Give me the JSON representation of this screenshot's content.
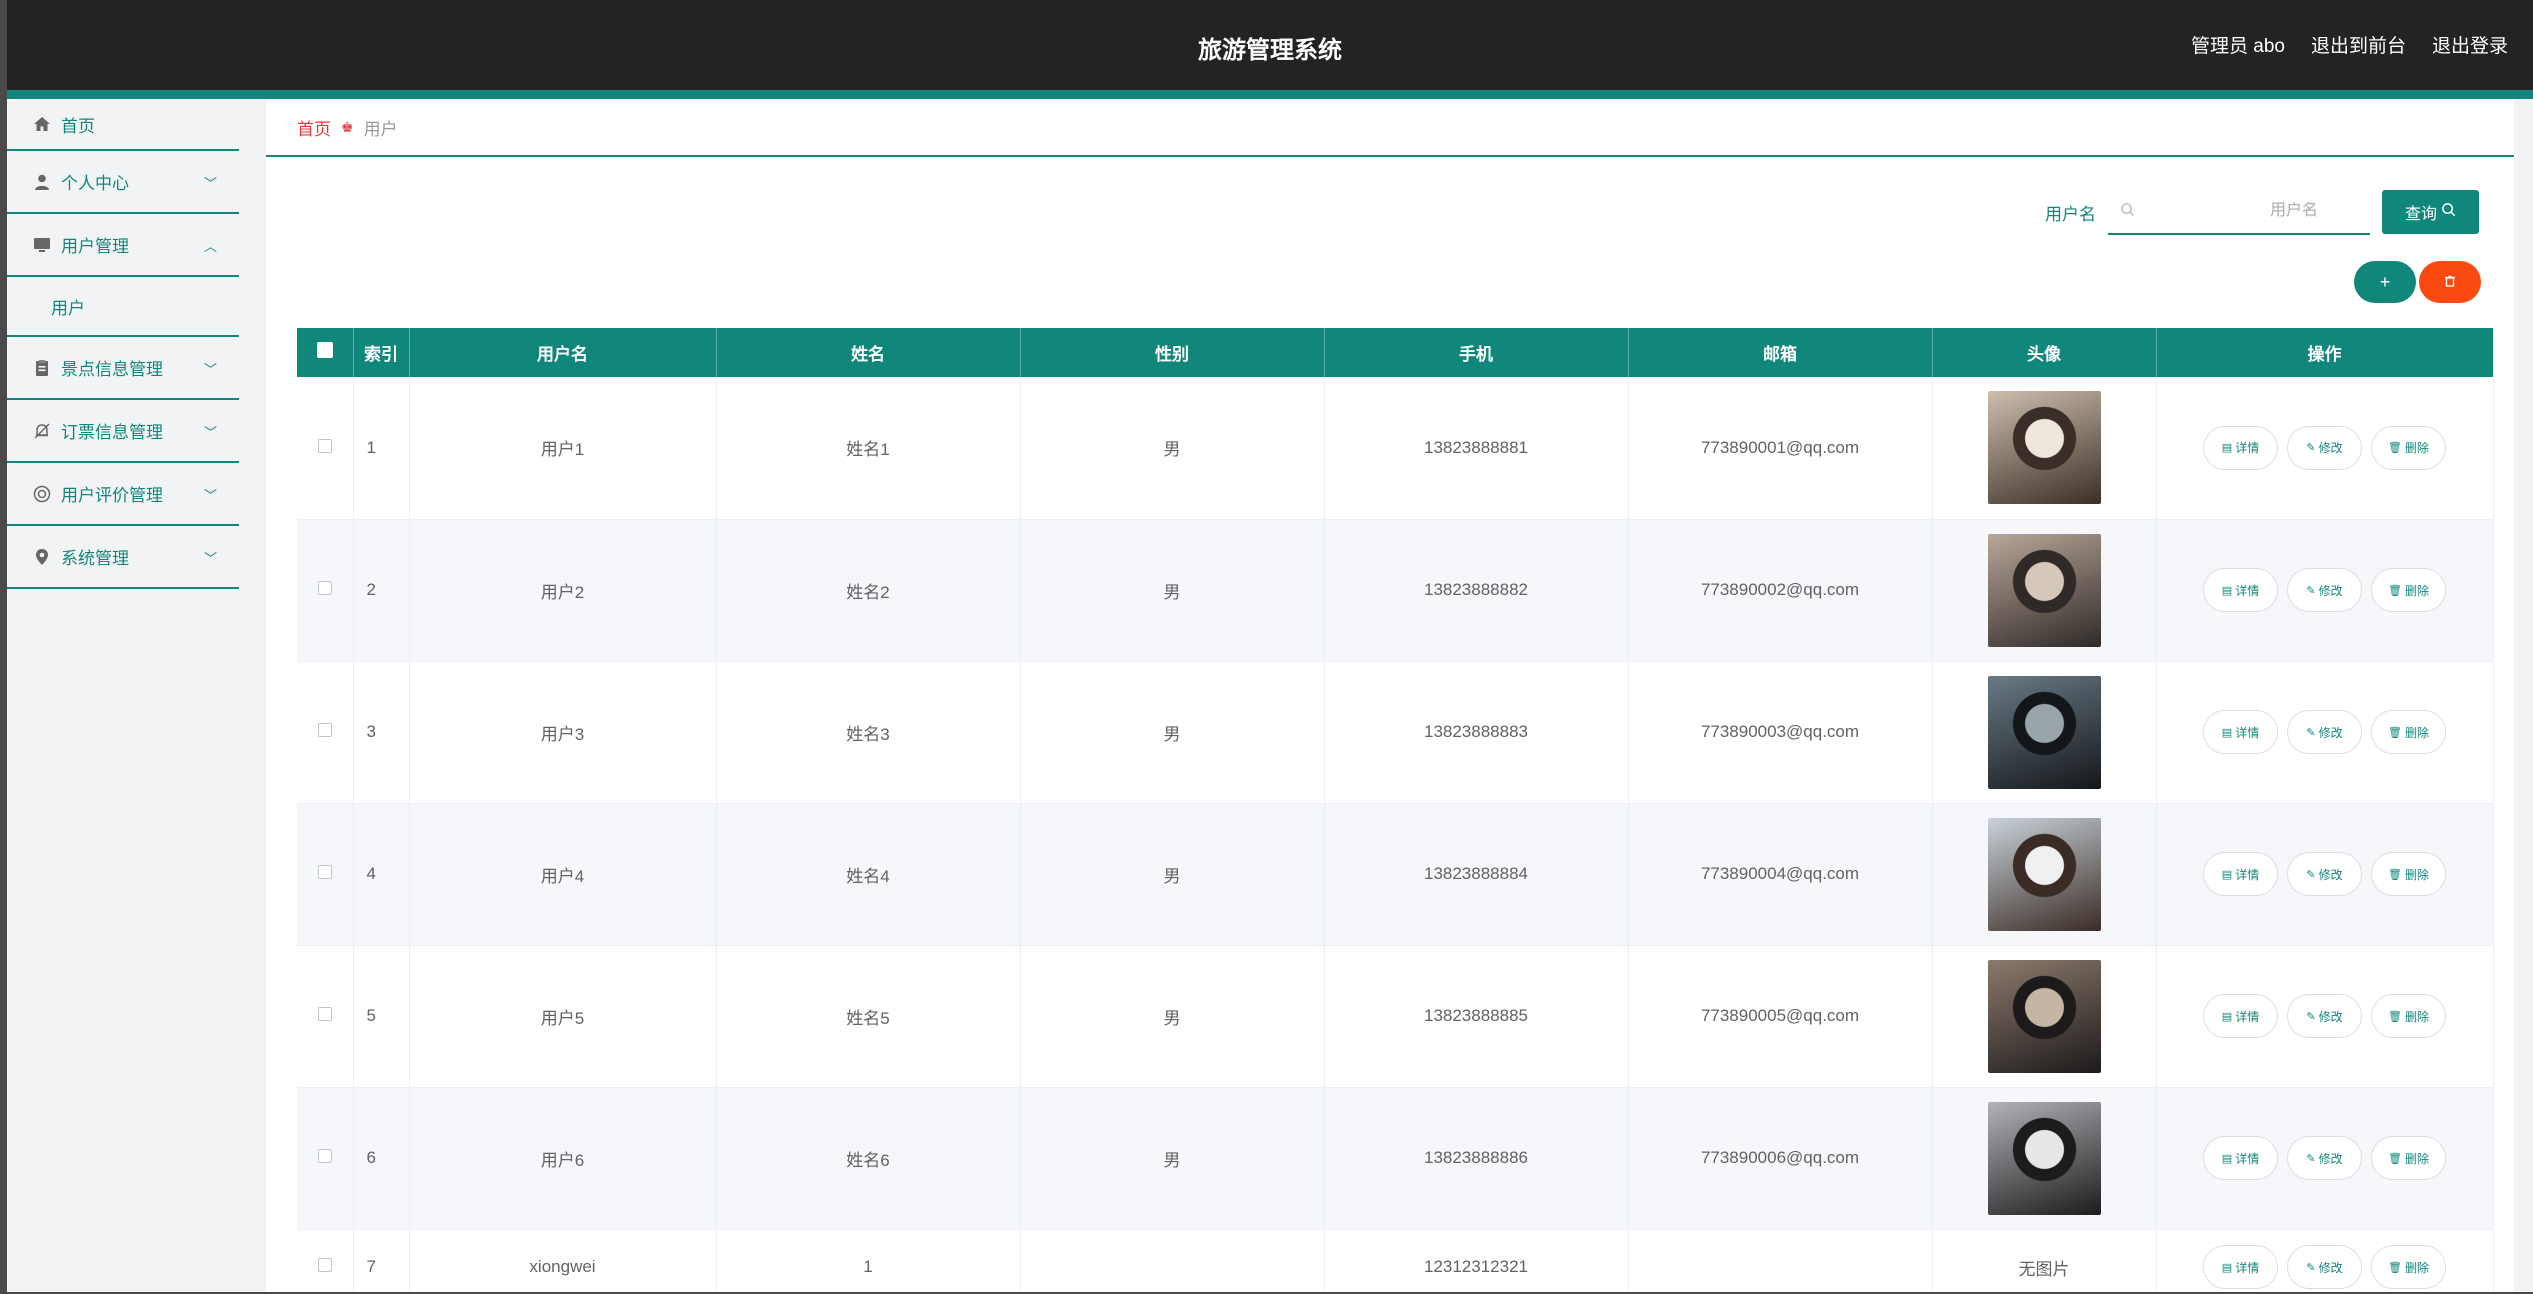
{
  "header": {
    "title": "旅游管理系统",
    "admin_label": "管理员 abo",
    "exit_front": "退出到前台",
    "logout": "退出登录"
  },
  "sidebar": {
    "home": "首页",
    "items": [
      {
        "label": "个人中心",
        "icon": "person-icon"
      },
      {
        "label": "用户管理",
        "icon": "monitor-icon",
        "expanded": true,
        "children": [
          "用户"
        ]
      },
      {
        "label": "景点信息管理",
        "icon": "clipboard-icon"
      },
      {
        "label": "订票信息管理",
        "icon": "bell-off-icon"
      },
      {
        "label": "用户评价管理",
        "icon": "chat-icon"
      },
      {
        "label": "系统管理",
        "icon": "pin-icon"
      }
    ]
  },
  "breadcrumb": {
    "home": "首页",
    "current": "用户"
  },
  "search": {
    "label": "用户名",
    "placeholder": "用户名",
    "button": "查询"
  },
  "table": {
    "headers": [
      "索引",
      "用户名",
      "姓名",
      "性别",
      "手机",
      "邮箱",
      "头像",
      "操作"
    ],
    "actions": {
      "detail": "详情",
      "edit": "修改",
      "delete": "删除"
    },
    "rows": [
      {
        "index": "1",
        "username": "用户1",
        "name": "姓名1",
        "gender": "男",
        "phone": "13823888881",
        "email": "773890001@qq.com",
        "avatar": ""
      },
      {
        "index": "2",
        "username": "用户2",
        "name": "姓名2",
        "gender": "男",
        "phone": "13823888882",
        "email": "773890002@qq.com",
        "avatar": ""
      },
      {
        "index": "3",
        "username": "用户3",
        "name": "姓名3",
        "gender": "男",
        "phone": "13823888883",
        "email": "773890003@qq.com",
        "avatar": ""
      },
      {
        "index": "4",
        "username": "用户4",
        "name": "姓名4",
        "gender": "男",
        "phone": "13823888884",
        "email": "773890004@qq.com",
        "avatar": ""
      },
      {
        "index": "5",
        "username": "用户5",
        "name": "姓名5",
        "gender": "男",
        "phone": "13823888885",
        "email": "773890005@qq.com",
        "avatar": ""
      },
      {
        "index": "6",
        "username": "用户6",
        "name": "姓名6",
        "gender": "男",
        "phone": "13823888886",
        "email": "773890006@qq.com",
        "avatar": ""
      },
      {
        "index": "7",
        "username": "xiongwei",
        "name": "1",
        "gender": "",
        "phone": "12312312321",
        "email": "",
        "avatar": "无图片"
      }
    ]
  },
  "colors": {
    "accent": "#11877b",
    "danger": "#fb4a11",
    "header_bg": "#232323"
  }
}
